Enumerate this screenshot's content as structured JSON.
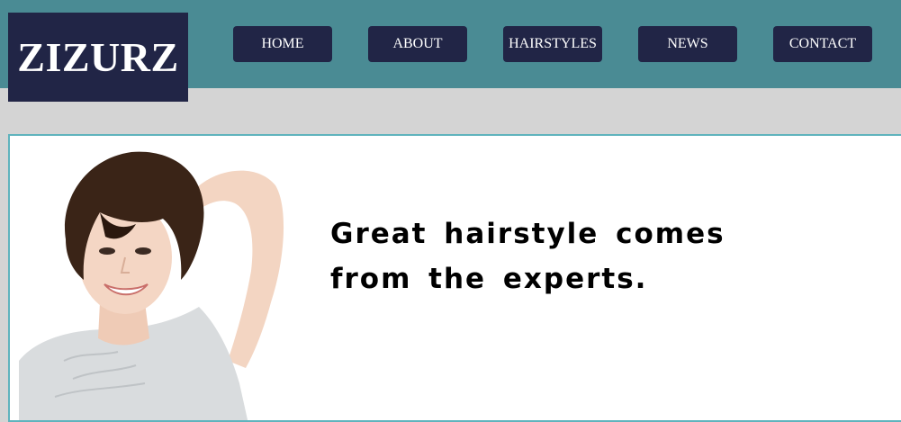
{
  "header": {
    "logo": "ZIZURZ",
    "nav": {
      "home": "HOME",
      "about": "ABOUT",
      "hairstyles": "HAIRSTYLES",
      "news": "NEWS",
      "contact": "CONTACT"
    }
  },
  "hero": {
    "headline_line1": "Great hairstyle comes",
    "headline_line2": "from the experts."
  },
  "colors": {
    "header_bg": "#4a8b94",
    "nav_bg": "#212546",
    "page_bg": "#d4d4d4",
    "hero_border": "#5fb3bd"
  }
}
